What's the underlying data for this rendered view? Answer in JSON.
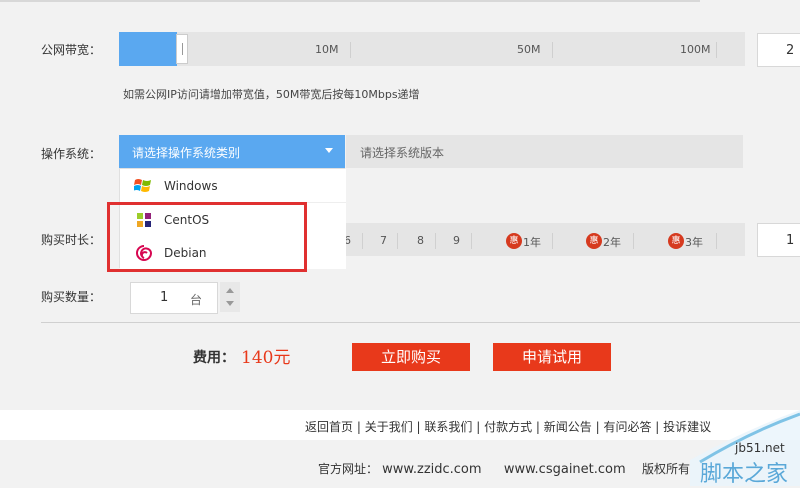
{
  "bandwidth": {
    "label": "公网带宽：",
    "ticks": [
      "10M",
      "50M",
      "100M"
    ],
    "value": "2",
    "fill_fraction": 0.09,
    "hint": "如需公网IP访问请增加带宽值，50M带宽后按每10Mbps递增"
  },
  "os": {
    "label": "操作系统：",
    "type_placeholder": "请选择操作系统类别",
    "version_placeholder": "请选择系统版本",
    "options": [
      "Windows",
      "CentOS",
      "Debian"
    ]
  },
  "duration": {
    "label": "购买时长：",
    "numbers": [
      "6",
      "7",
      "8",
      "9"
    ],
    "promo_badge": "惠",
    "promos": [
      "1年",
      "2年",
      "3年"
    ],
    "value": "1"
  },
  "quantity": {
    "label": "购买数量：",
    "value": "1",
    "unit": "台"
  },
  "price": {
    "label": "费用：",
    "amount": "140元"
  },
  "buttons": {
    "buy": "立即购买",
    "trial": "申请试用"
  },
  "footer": {
    "links": [
      "返回首页",
      "关于我们",
      "联系我们",
      "付款方式",
      "新闻公告",
      "有问必答",
      "投诉建议"
    ],
    "site_label": "官方网址：",
    "sites": [
      "www.zzidc.com",
      "www.csgainet.com"
    ],
    "copyright": "版权所有"
  },
  "watermark": {
    "url": "jb51.net",
    "name": "脚本之家"
  },
  "colors": {
    "accent_blue": "#5aa8f0",
    "brand_red": "#e8391b",
    "highlight_red": "#e03030"
  }
}
